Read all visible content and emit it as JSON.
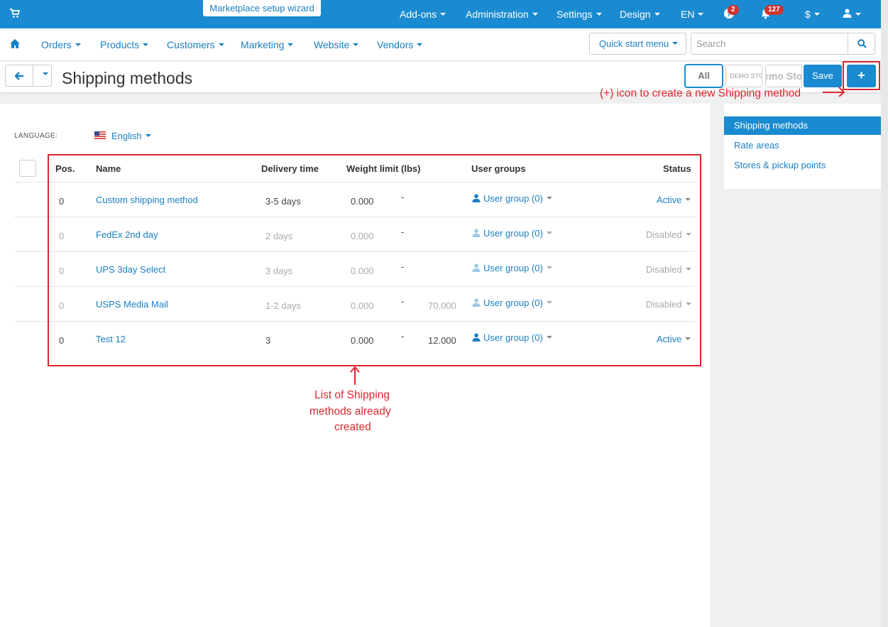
{
  "topbar": {
    "wizard_label": "Marketplace setup wizard",
    "addons": "Add-ons",
    "administration": "Administration",
    "settings": "Settings",
    "design": "Design",
    "language": "EN",
    "help_badge": "2",
    "notifications_badge": "127",
    "currency": "$"
  },
  "subnav": {
    "orders": "Orders",
    "products": "Products",
    "customers": "Customers",
    "marketing": "Marketing",
    "website": "Website",
    "vendors": "Vendors",
    "quick_start": "Quick start menu",
    "search_placeholder": "Search"
  },
  "titlebar": {
    "title": "Shipping methods",
    "all_label": "All",
    "demo_label_1": "DEMO STORE",
    "demo_label_2": "Demo Store",
    "save_label": "Save",
    "add_label": "+"
  },
  "language": {
    "label": "LANGUAGE:",
    "value": "English"
  },
  "table": {
    "headers": {
      "pos": "Pos.",
      "name": "Name",
      "delivery": "Delivery time",
      "weight": "Weight limit (lbs)",
      "usergroups": "User groups",
      "status": "Status"
    },
    "rows": [
      {
        "pos": "0",
        "name": "Custom shipping method",
        "delivery": "3-5 days",
        "weight_min": "0.000",
        "dash": "-",
        "weight_max": "",
        "usergroup": "User group (0)",
        "status": "Active",
        "enabled": true
      },
      {
        "pos": "0",
        "name": "FedEx 2nd day",
        "delivery": "2 days",
        "weight_min": "0.000",
        "dash": "-",
        "weight_max": "",
        "usergroup": "User group (0)",
        "status": "Disabled",
        "enabled": false
      },
      {
        "pos": "0",
        "name": "UPS 3day Select",
        "delivery": "3 days",
        "weight_min": "0.000",
        "dash": "-",
        "weight_max": "",
        "usergroup": "User group (0)",
        "status": "Disabled",
        "enabled": false
      },
      {
        "pos": "0",
        "name": "USPS Media Mail",
        "delivery": "1-2 days",
        "weight_min": "0.000",
        "dash": "-",
        "weight_max": "70.000",
        "usergroup": "User group (0)",
        "status": "Disabled",
        "enabled": false
      },
      {
        "pos": "0",
        "name": "Test 12",
        "delivery": "3",
        "weight_min": "0.000",
        "dash": "-",
        "weight_max": "12.000",
        "usergroup": "User group (0)",
        "status": "Active",
        "enabled": true
      }
    ]
  },
  "sidebar": {
    "items": [
      {
        "label": "Shipping methods",
        "active": true
      },
      {
        "label": "Rate areas",
        "active": false
      },
      {
        "label": "Stores & pickup points",
        "active": false
      }
    ]
  },
  "annotations": {
    "add_note": "(+) icon to create a new Shipping method",
    "list_note_1": "List of Shipping",
    "list_note_2": "methods already",
    "list_note_3": "created"
  },
  "colors": {
    "brand": "#1a8bd0",
    "link": "#1a7fc1",
    "annotation": "#d9282f",
    "badge": "#cc3333"
  }
}
